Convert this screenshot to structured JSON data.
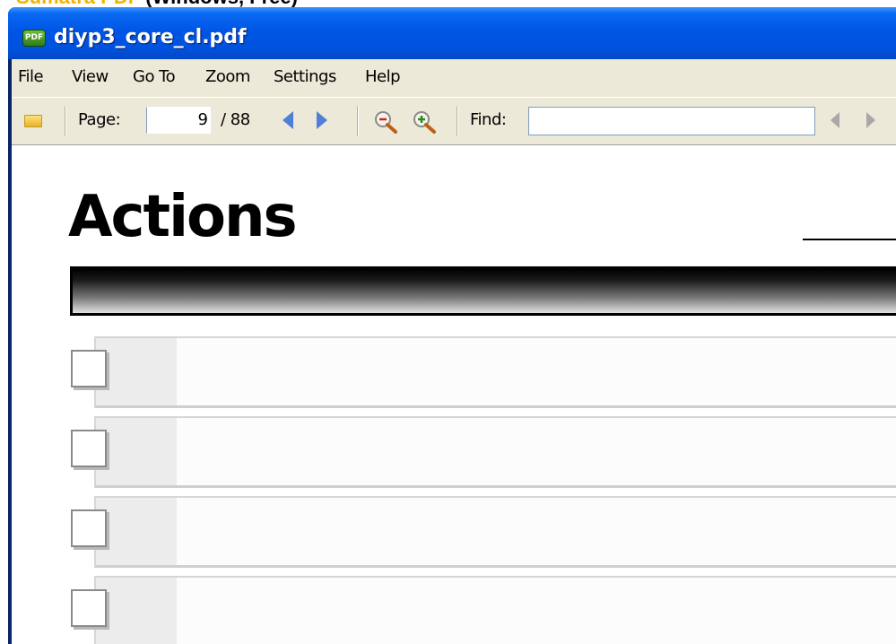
{
  "caption": {
    "part1": "Sumatra PDF",
    "part2": "(Windows, Free)"
  },
  "window": {
    "title": "diyp3_core_cl.pdf",
    "app_icon": "pdf-icon",
    "app_icon_text": "PDF"
  },
  "menu": {
    "items": [
      {
        "label": "File"
      },
      {
        "label": "View"
      },
      {
        "label": "Go To"
      },
      {
        "label": "Zoom"
      },
      {
        "label": "Settings"
      },
      {
        "label": "Help"
      }
    ]
  },
  "toolbar": {
    "open_icon": "folder-icon",
    "page_label": "Page:",
    "page_value": "9",
    "page_total": "/ 88",
    "prev_icon": "arrow-left-icon",
    "next_icon": "arrow-right-icon",
    "zoom_out_icon": "zoom-out-icon",
    "zoom_in_icon": "zoom-in-icon",
    "find_label": "Find:",
    "find_value": "",
    "find_prev_icon": "find-prev-icon",
    "find_next_icon": "find-next-icon"
  },
  "document": {
    "heading": "Actions",
    "rows": [
      {
        "checked": false
      },
      {
        "checked": false
      },
      {
        "checked": false
      },
      {
        "checked": false
      }
    ]
  },
  "colors": {
    "titlebar": "#0055e5",
    "chrome": "#ece9d8",
    "arrow_blue": "#4f7fd8",
    "caption_accent": "#f0b400"
  }
}
